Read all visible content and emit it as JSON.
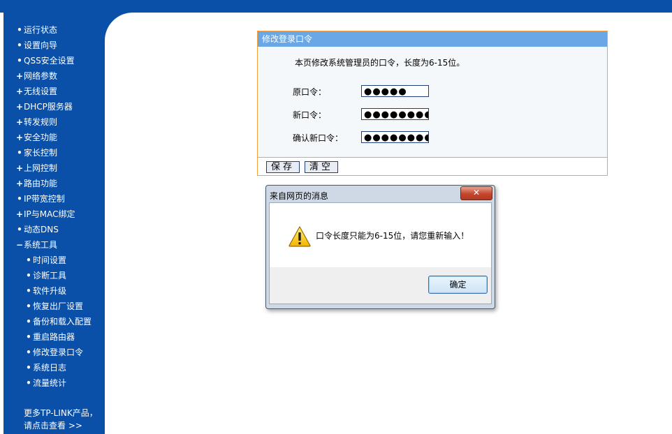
{
  "sidebar": {
    "items": [
      {
        "bullet": "•",
        "label": "运行状态",
        "sub": false
      },
      {
        "bullet": "•",
        "label": "设置向导",
        "sub": false
      },
      {
        "bullet": "•",
        "label": "QSS安全设置",
        "sub": false
      },
      {
        "bullet": "+",
        "label": "网络参数",
        "sub": false
      },
      {
        "bullet": "+",
        "label": "无线设置",
        "sub": false
      },
      {
        "bullet": "+",
        "label": "DHCP服务器",
        "sub": false
      },
      {
        "bullet": "+",
        "label": "转发规则",
        "sub": false
      },
      {
        "bullet": "+",
        "label": "安全功能",
        "sub": false
      },
      {
        "bullet": "•",
        "label": "家长控制",
        "sub": false
      },
      {
        "bullet": "+",
        "label": "上网控制",
        "sub": false
      },
      {
        "bullet": "+",
        "label": "路由功能",
        "sub": false
      },
      {
        "bullet": "•",
        "label": "IP带宽控制",
        "sub": false
      },
      {
        "bullet": "+",
        "label": "IP与MAC绑定",
        "sub": false
      },
      {
        "bullet": "•",
        "label": "动态DNS",
        "sub": false
      },
      {
        "bullet": "−",
        "label": "系统工具",
        "sub": false
      },
      {
        "bullet": "•",
        "label": "时间设置",
        "sub": true
      },
      {
        "bullet": "•",
        "label": "诊断工具",
        "sub": true
      },
      {
        "bullet": "•",
        "label": "软件升级",
        "sub": true
      },
      {
        "bullet": "•",
        "label": "恢复出厂设置",
        "sub": true
      },
      {
        "bullet": "•",
        "label": "备份和载入配置",
        "sub": true
      },
      {
        "bullet": "•",
        "label": "重启路由器",
        "sub": true
      },
      {
        "bullet": "•",
        "label": "修改登录口令",
        "sub": true
      },
      {
        "bullet": "•",
        "label": "系统日志",
        "sub": true
      },
      {
        "bullet": "•",
        "label": "流量统计",
        "sub": true
      }
    ],
    "more_line1": "更多TP-LINK产品，",
    "more_line2": "请点击查看 >>"
  },
  "panel": {
    "title": "修改登录口令",
    "description": "本页修改系统管理员的口令，长度为6-15位。",
    "old_label": "原口令：",
    "old_value": "●●●●●",
    "new_label": "新口令：",
    "new_value": "●●●●●●●●●●",
    "confirm_label": "确认新口令：",
    "confirm_value": "●●●●●●●●●●",
    "save_label": "保存",
    "clear_label": "清空"
  },
  "dialog": {
    "title": "来自网页的消息",
    "close_label": "✕",
    "message": "口令长度只能为6-15位，请您重新输入！",
    "ok_label": "确定",
    "icon": "warning-icon"
  },
  "colors": {
    "nav_blue": "#0a4fa8",
    "panel_title": "#6aa7e6",
    "panel_border": "#f5a23c"
  }
}
